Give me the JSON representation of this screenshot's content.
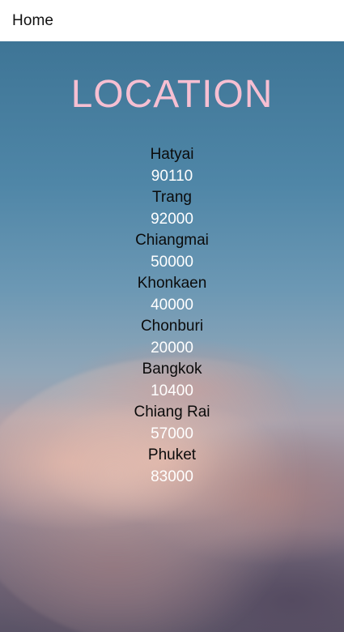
{
  "app_bar": {
    "title": "Home"
  },
  "page": {
    "title": "LOCATION"
  },
  "locations": [
    {
      "city": "Hatyai",
      "postal": "90110"
    },
    {
      "city": "Trang",
      "postal": "92000"
    },
    {
      "city": "Chiangmai",
      "postal": "50000"
    },
    {
      "city": "Khonkaen",
      "postal": "40000"
    },
    {
      "city": "Chonburi",
      "postal": "20000"
    },
    {
      "city": "Bangkok",
      "postal": "10400"
    },
    {
      "city": "Chiang Rai",
      "postal": "57000"
    },
    {
      "city": "Phuket",
      "postal": "83000"
    }
  ],
  "colors": {
    "title": "#f6bfd2",
    "city_text": "#0b0b0b",
    "postal_text": "#ffffff",
    "app_bar_bg": "#ffffff"
  }
}
